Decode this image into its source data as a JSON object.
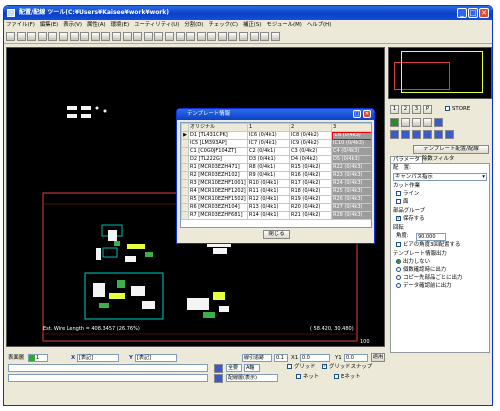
{
  "window": {
    "title": "配置/配線 ツール(C:¥Users¥Kaisee¥work¥work)",
    "minimize": "_",
    "maximize": "□",
    "close": "✕"
  },
  "menubar": [
    "ファイル(F)",
    "編集(E)",
    "表示(V)",
    "属性(A)",
    "環境(E)",
    "ユーティリティ(U)",
    "分割(D)",
    "チェック(C)",
    "補正(S)",
    "モジュール(M)",
    "ヘルプ(H)"
  ],
  "canvas": {
    "status_left": "Est. Wire Length = 408.3457 (26.76%)",
    "status_right": "( 58.420,  30.480)",
    "scale_right": "100",
    "colors": {
      "background": "#000000",
      "board_outline": "#d84040",
      "copper": "#f4f4f4",
      "component": "#00e5d8",
      "highlight": "#e8ff40",
      "route": "#3bb04a"
    }
  },
  "dialog": {
    "title": "テンプレート情報",
    "columns": [
      "オリジナル",
      "1",
      "2",
      "3"
    ],
    "rows": [
      {
        "original": "D1 [TL431CPK]",
        "c1": "IC6 (0/4k1)",
        "c2": "IC8 (0/4k2)",
        "c3": "IC6 (0/4k3)"
      },
      {
        "original": "IC5 [LM393AP]",
        "c1": "IC7 (0/4k1)",
        "c2": "IC9 (0/4k2)",
        "c3": "IC10 (0/4k3)"
      },
      {
        "original": "C1 [C0G0JF104ZT]",
        "c1": "C2 (0/4k1)",
        "c2": "C3 (0/4k2)",
        "c3": "C4 (0/4k3)"
      },
      {
        "original": "D2 [TL222G]",
        "c1": "D3 (0/4k1)",
        "c2": "D4 (0/4k2)",
        "c3": "D5 (0/4k3)"
      },
      {
        "original": "R1 [MCR03EZH471]",
        "c1": "R8 (0/4k1)",
        "c2": "R15 (0/4k2)",
        "c3": "R22 (0/4k3)"
      },
      {
        "original": "R2 [MCR03EZH102]",
        "c1": "R9 (0/4k1)",
        "c2": "R16 (0/4k2)",
        "c3": "R23 (0/4k3)"
      },
      {
        "original": "R3 [MCR10EZHF1001]",
        "c1": "R10 (0/4k1)",
        "c2": "R17 (0/4k2)",
        "c3": "R24 (0/4k3)"
      },
      {
        "original": "R4 [MCR10EZHF1202]",
        "c1": "R11 (0/4k1)",
        "c2": "R18 (0/4k2)",
        "c3": "R25 (0/4k3)"
      },
      {
        "original": "R5 [MCR10EZHF1502]",
        "c1": "R12 (0/4k1)",
        "c2": "R19 (0/4k2)",
        "c3": "R26 (0/4k3)"
      },
      {
        "original": "R6 [MCR03EZH104]",
        "c1": "R13 (0/4k1)",
        "c2": "R20 (0/4k2)",
        "c3": "R27 (0/4k3)"
      },
      {
        "original": "R7 [MCR03EZHF681]",
        "c1": "R14 (0/4k1)",
        "c2": "R21 (0/4k2)",
        "c3": "R28 (0/4k3)"
      }
    ],
    "close_button": "閉じる"
  },
  "right_panel": {
    "page_buttons": [
      "1",
      "2",
      "3",
      "P"
    ],
    "store_label": "STORE",
    "template_place_button": "テンプレート配置/配線",
    "tabs": [
      "パラメータ",
      "除数フィルタ"
    ],
    "placement_label": "配　置:",
    "placement_value": "キャンパス指示",
    "cut_legend": "カット作業",
    "cut_line": "ライン",
    "cut_face": "面",
    "group_legend": "部品グループ",
    "group_keep": "保存する",
    "rotation_legend": "回転",
    "angle_label": "角度:",
    "angle_value": "90.000",
    "via_sync": "ビアの角度3回配置する",
    "output_legend": "テンプレート情報出力",
    "out_opts": [
      "出力しない",
      "個数確認時に出力",
      "コピー先部品ごとに出力",
      "データ確認前に出力"
    ]
  },
  "bottom": {
    "layer_label": "表面層",
    "layer_value": "1",
    "x_label": "X",
    "x_value": "[表記]",
    "y_label": "Y",
    "y_value": "[表記]",
    "mode_value": "線引追跡",
    "grid_value": "0.1",
    "x1_label": "X1",
    "x1_value": "0.0",
    "y1_label": "Y1",
    "y1_value": "0.0",
    "apply_label": "適用",
    "snap_value": "全要",
    "dir_value": "A軸",
    "grid_chk": "グリッド",
    "grid_snap_chk": "グリッドスナップ",
    "layer_show": "配線層(表示)",
    "net_label": "ネット",
    "net2_label": "Eネット"
  }
}
